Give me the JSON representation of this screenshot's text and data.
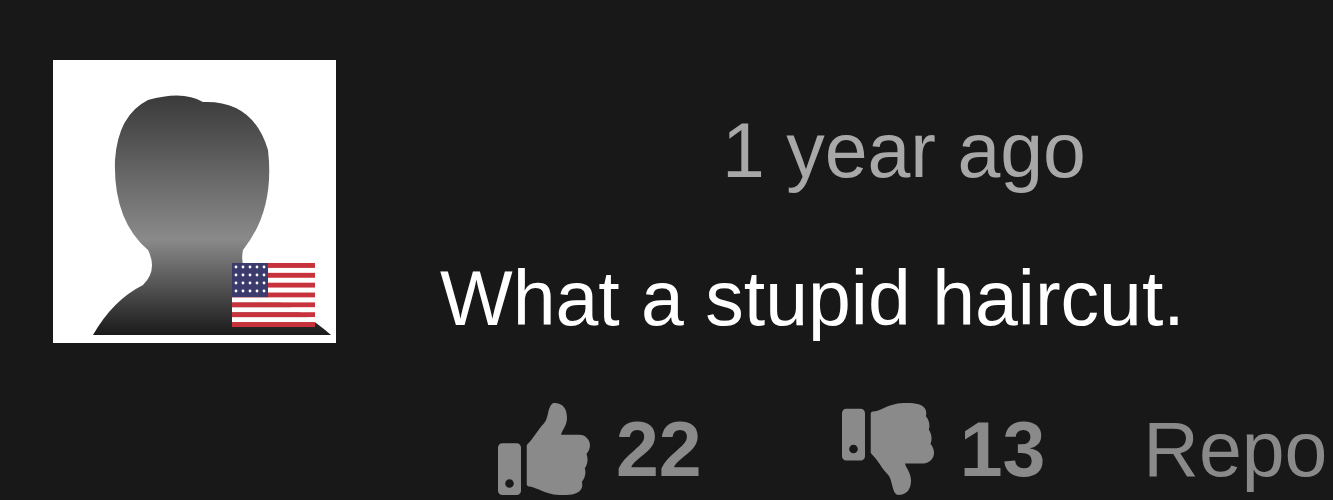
{
  "comment": {
    "timestamp": "1 year ago",
    "text": "What a stupid haircut.",
    "likes": "22",
    "dislikes": "13",
    "report": "Repo"
  }
}
